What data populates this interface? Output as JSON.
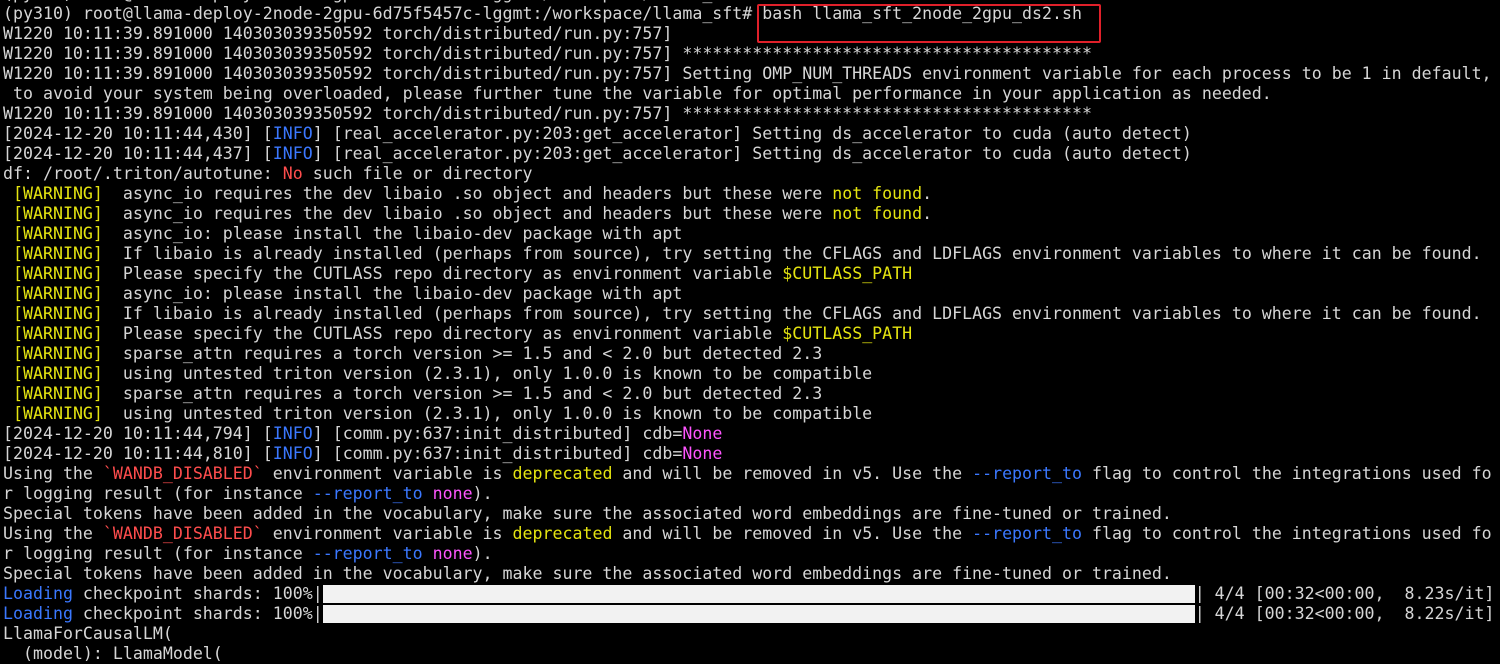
{
  "terminal": {
    "colors": {
      "default": "#d6d6d6",
      "blue": "#3b78ff",
      "yellow": "#e5e510",
      "red": "#ff4d4d",
      "magenta": "#ff55ff",
      "progress_fill": "#f2f2f2",
      "highlight": "#e0202a"
    },
    "lines": [
      {
        "segments": [
          {
            "t": "(py310) root@llama-deploy-2node-2gpu-6d75f5457c-lggmt:/workspace/llama_sft#"
          }
        ]
      },
      {
        "segments": [
          {
            "t": "(py310) root@llama-deploy-2node-2gpu-6d75f5457c-lggmt:/workspace/llama_sft# "
          },
          {
            "t": "bash llama_sft_2node_2gpu_ds2.sh"
          }
        ]
      },
      {
        "segments": [
          {
            "t": "W1220 10:11:39.891000 140303039350592 torch/distributed/run.py:757]"
          }
        ]
      },
      {
        "segments": [
          {
            "t": "W1220 10:11:39.891000 140303039350592 torch/distributed/run.py:757] *****************************************"
          }
        ]
      },
      {
        "segments": [
          {
            "t": "W1220 10:11:39.891000 140303039350592 torch/distributed/run.py:757] Setting OMP_NUM_THREADS environment variable for each process to be 1 in default,"
          }
        ]
      },
      {
        "segments": [
          {
            "t": " to avoid your system being overloaded, please further tune the variable for optimal performance in your application as needed."
          }
        ]
      },
      {
        "segments": [
          {
            "t": "W1220 10:11:39.891000 140303039350592 torch/distributed/run.py:757] *****************************************"
          }
        ]
      },
      {
        "segments": [
          {
            "t": "[2024-12-20 10:11:44,430] ["
          },
          {
            "t": "INFO",
            "c": "blue"
          },
          {
            "t": "] [real_accelerator.py:203:get_accelerator] Setting ds_accelerator to cuda (auto detect)"
          }
        ]
      },
      {
        "segments": [
          {
            "t": "[2024-12-20 10:11:44,437] ["
          },
          {
            "t": "INFO",
            "c": "blue"
          },
          {
            "t": "] [real_accelerator.py:203:get_accelerator] Setting ds_accelerator to cuda (auto detect)"
          }
        ]
      },
      {
        "segments": [
          {
            "t": "df: /root/.triton/autotune: "
          },
          {
            "t": "No",
            "c": "red"
          },
          {
            "t": " such file or directory"
          }
        ]
      },
      {
        "segments": [
          {
            "t": " "
          },
          {
            "t": "[WARNING]",
            "c": "yellow"
          },
          {
            "t": "  async_io requires the dev libaio .so object and headers but these were "
          },
          {
            "t": "not found",
            "c": "yellow"
          },
          {
            "t": "."
          }
        ]
      },
      {
        "segments": [
          {
            "t": " "
          },
          {
            "t": "[WARNING]",
            "c": "yellow"
          },
          {
            "t": "  async_io requires the dev libaio .so object and headers but these were "
          },
          {
            "t": "not found",
            "c": "yellow"
          },
          {
            "t": "."
          }
        ]
      },
      {
        "segments": [
          {
            "t": " "
          },
          {
            "t": "[WARNING]",
            "c": "yellow"
          },
          {
            "t": "  async_io: please install the libaio-dev package with apt"
          }
        ]
      },
      {
        "segments": [
          {
            "t": " "
          },
          {
            "t": "[WARNING]",
            "c": "yellow"
          },
          {
            "t": "  If libaio is already installed (perhaps from source), try setting the CFLAGS and LDFLAGS environment variables to where it can be found."
          }
        ]
      },
      {
        "segments": [
          {
            "t": " "
          },
          {
            "t": "[WARNING]",
            "c": "yellow"
          },
          {
            "t": "  Please specify the CUTLASS repo directory as environment variable "
          },
          {
            "t": "$CUTLASS_PATH",
            "c": "yellow"
          }
        ]
      },
      {
        "segments": [
          {
            "t": " "
          },
          {
            "t": "[WARNING]",
            "c": "yellow"
          },
          {
            "t": "  async_io: please install the libaio-dev package with apt"
          }
        ]
      },
      {
        "segments": [
          {
            "t": " "
          },
          {
            "t": "[WARNING]",
            "c": "yellow"
          },
          {
            "t": "  If libaio is already installed (perhaps from source), try setting the CFLAGS and LDFLAGS environment variables to where it can be found."
          }
        ]
      },
      {
        "segments": [
          {
            "t": " "
          },
          {
            "t": "[WARNING]",
            "c": "yellow"
          },
          {
            "t": "  Please specify the CUTLASS repo directory as environment variable "
          },
          {
            "t": "$CUTLASS_PATH",
            "c": "yellow"
          }
        ]
      },
      {
        "segments": [
          {
            "t": " "
          },
          {
            "t": "[WARNING]",
            "c": "yellow"
          },
          {
            "t": "  sparse_attn requires a torch version >= 1.5 and < 2.0 but detected 2.3"
          }
        ]
      },
      {
        "segments": [
          {
            "t": " "
          },
          {
            "t": "[WARNING]",
            "c": "yellow"
          },
          {
            "t": "  using untested triton version (2.3.1), only 1.0.0 is known to be compatible"
          }
        ]
      },
      {
        "segments": [
          {
            "t": " "
          },
          {
            "t": "[WARNING]",
            "c": "yellow"
          },
          {
            "t": "  sparse_attn requires a torch version >= 1.5 and < 2.0 but detected 2.3"
          }
        ]
      },
      {
        "segments": [
          {
            "t": " "
          },
          {
            "t": "[WARNING]",
            "c": "yellow"
          },
          {
            "t": "  using untested triton version (2.3.1), only 1.0.0 is known to be compatible"
          }
        ]
      },
      {
        "segments": [
          {
            "t": "[2024-12-20 10:11:44,794] ["
          },
          {
            "t": "INFO",
            "c": "blue"
          },
          {
            "t": "] [comm.py:637:init_distributed] cdb="
          },
          {
            "t": "None",
            "c": "magenta"
          }
        ]
      },
      {
        "segments": [
          {
            "t": "[2024-12-20 10:11:44,810] ["
          },
          {
            "t": "INFO",
            "c": "blue"
          },
          {
            "t": "] [comm.py:637:init_distributed] cdb="
          },
          {
            "t": "None",
            "c": "magenta"
          }
        ]
      },
      {
        "segments": [
          {
            "t": "Using the "
          },
          {
            "t": "`WANDB_DISABLED`",
            "c": "red"
          },
          {
            "t": " environment variable is "
          },
          {
            "t": "deprecated",
            "c": "yellow"
          },
          {
            "t": " and will be removed in v5. Use the "
          },
          {
            "t": "--report_to",
            "c": "blue"
          },
          {
            "t": " flag to control the integrations used fo"
          }
        ]
      },
      {
        "segments": [
          {
            "t": "r logging result (for instance "
          },
          {
            "t": "--report_to",
            "c": "blue"
          },
          {
            "t": " "
          },
          {
            "t": "none",
            "c": "magenta"
          },
          {
            "t": ")."
          }
        ]
      },
      {
        "segments": [
          {
            "t": "Special tokens have been added in the vocabulary, make sure the associated word embeddings are fine-tuned or trained."
          }
        ]
      },
      {
        "segments": [
          {
            "t": "Using the "
          },
          {
            "t": "`WANDB_DISABLED`",
            "c": "red"
          },
          {
            "t": " environment variable is "
          },
          {
            "t": "deprecated",
            "c": "yellow"
          },
          {
            "t": " and will be removed in v5. Use the "
          },
          {
            "t": "--report_to",
            "c": "blue"
          },
          {
            "t": " flag to control the integrations used fo"
          }
        ]
      },
      {
        "segments": [
          {
            "t": "r logging result (for instance "
          },
          {
            "t": "--report_to",
            "c": "blue"
          },
          {
            "t": " "
          },
          {
            "t": "none",
            "c": "magenta"
          },
          {
            "t": ")."
          }
        ]
      },
      {
        "segments": [
          {
            "t": "Special tokens have been added in the vocabulary, make sure the associated word embeddings are fine-tuned or trained."
          }
        ]
      },
      {
        "segments": [
          {
            "t": "Loading",
            "c": "blue"
          },
          {
            "t": " checkpoint shards: 100%|"
          },
          {
            "progress": 1.0
          },
          {
            "t": "| 4/4 [00:32<00:00,  8.23s/it]"
          }
        ]
      },
      {
        "segments": [
          {
            "t": "Loading",
            "c": "blue"
          },
          {
            "t": " checkpoint shards: 100%|"
          },
          {
            "progress": 1.0
          },
          {
            "t": "| 4/4 [00:32<00:00,  8.22s/it]"
          }
        ]
      },
      {
        "segments": [
          {
            "t": "LlamaForCausalLM("
          }
        ]
      },
      {
        "segments": [
          {
            "t": "  (model): LlamaModel("
          }
        ]
      }
    ],
    "highlighted_command": "bash llama_sft_2node_2gpu_ds2.sh"
  }
}
